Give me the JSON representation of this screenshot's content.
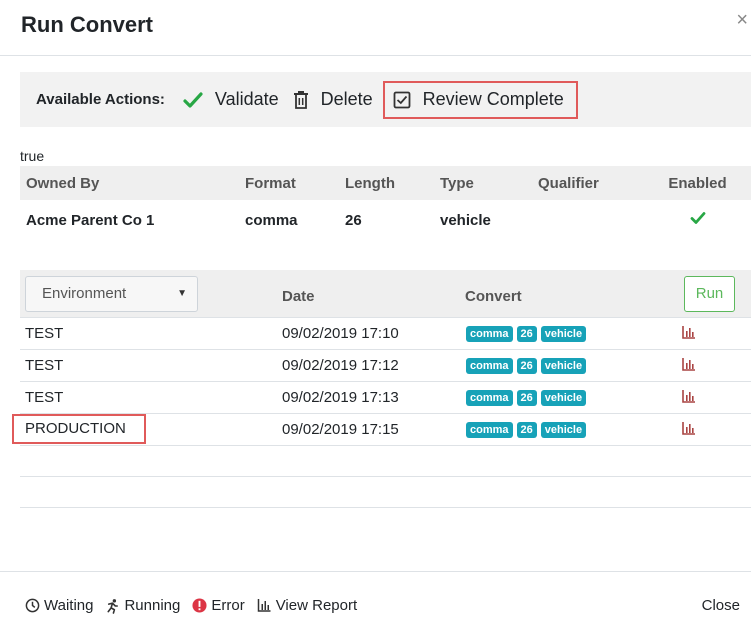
{
  "modal": {
    "title": "Run Convert",
    "close_glyph": "×"
  },
  "actions": {
    "label": "Available Actions:",
    "validate": {
      "label": "Validate",
      "icon": "check-icon"
    },
    "delete": {
      "label": "Delete",
      "icon": "trash-icon"
    },
    "review": {
      "label": "Review Complete",
      "icon": "checkbox-checked-icon"
    }
  },
  "status_text": "true",
  "owner_table": {
    "headers": [
      "Owned By",
      "Format",
      "Length",
      "Type",
      "Qualifier",
      "Enabled"
    ],
    "row": {
      "owned_by": "Acme Parent Co 1",
      "format": "comma",
      "length": "26",
      "type": "vehicle",
      "qualifier": "",
      "enabled_icon": "check-icon"
    }
  },
  "runs": {
    "environment_select": "Environment",
    "headers": {
      "date": "Date",
      "convert": "Convert"
    },
    "run_button": "Run",
    "rows": [
      {
        "env": "TEST",
        "date": "09/02/2019 17:10",
        "badges": [
          "comma",
          "26",
          "vehicle"
        ]
      },
      {
        "env": "TEST",
        "date": "09/02/2019 17:12",
        "badges": [
          "comma",
          "26",
          "vehicle"
        ]
      },
      {
        "env": "TEST",
        "date": "09/02/2019 17:13",
        "badges": [
          "comma",
          "26",
          "vehicle"
        ]
      },
      {
        "env": "PRODUCTION",
        "date": "09/02/2019 17:15",
        "badges": [
          "comma",
          "26",
          "vehicle"
        ]
      }
    ]
  },
  "footer": {
    "legend": {
      "waiting": "Waiting",
      "running": "Running",
      "error": "Error",
      "view_report": "View Report"
    },
    "close": "Close"
  },
  "colors": {
    "success": "#28a745",
    "badge": "#17a2b8",
    "error": "#dc3545",
    "report_icon": "#a94442",
    "highlight_border": "#e05a5a"
  }
}
